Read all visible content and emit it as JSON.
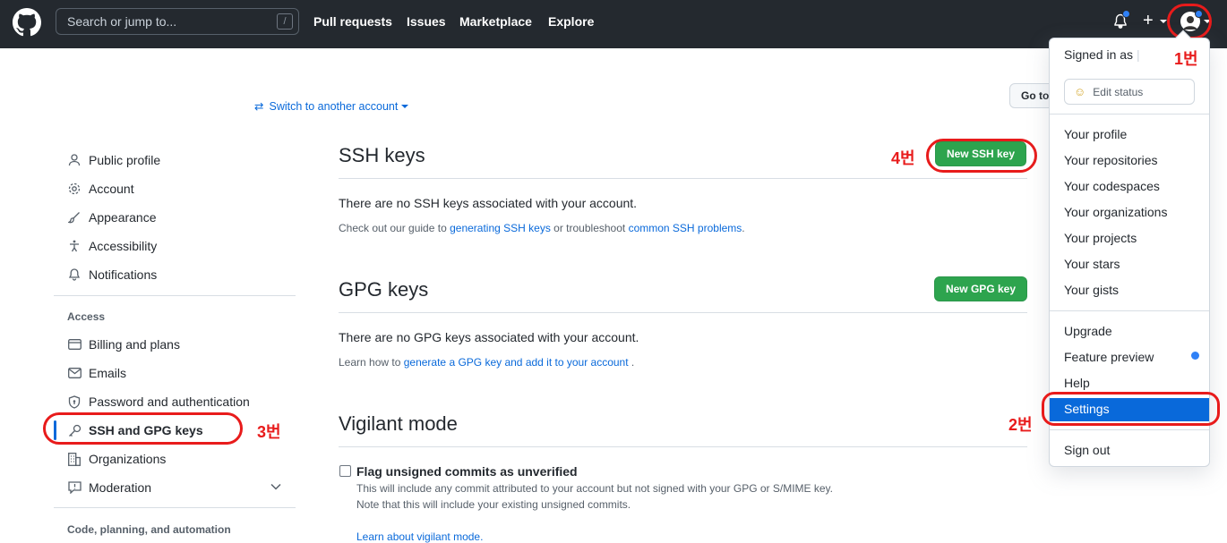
{
  "header": {
    "search_placeholder": "Search or jump to...",
    "search_shortcut": "/",
    "nav": [
      "Pull requests",
      "Issues",
      "Marketplace",
      "Explore"
    ]
  },
  "switch_account": "Switch to another account",
  "goto_button": "Go to",
  "sidebar": {
    "items": [
      "Public profile",
      "Account",
      "Appearance",
      "Accessibility",
      "Notifications"
    ],
    "access_heading": "Access",
    "access_items": [
      "Billing and plans",
      "Emails",
      "Password and authentication",
      "SSH and GPG keys",
      "Organizations",
      "Moderation"
    ],
    "code_heading": "Code, planning, and automation"
  },
  "ssh": {
    "title": "SSH keys",
    "button": "New SSH key",
    "empty": "There are no SSH keys associated with your account.",
    "guide_pre": "Check out our guide to",
    "guide_link1": "generating SSH keys",
    "guide_mid": "or troubleshoot",
    "guide_link2": "common SSH problems",
    "guide_end": "."
  },
  "gpg": {
    "title": "GPG keys",
    "button": "New GPG key",
    "empty": "There are no GPG keys associated with your account.",
    "learn_pre": "Learn how to",
    "learn_link": "generate a GPG key and add it to your account",
    "learn_end": "."
  },
  "vigilant": {
    "title": "Vigilant mode",
    "checkbox_label": "Flag unsigned commits as unverified",
    "note1": "This will include any commit attributed to your account but not signed with your GPG or S/MIME key.",
    "note2": "Note that this will include your existing unsigned commits.",
    "link": "Learn about vigilant mode."
  },
  "dropdown": {
    "signed_in": "Signed in as",
    "edit_status": "Edit status",
    "group1": [
      "Your profile",
      "Your repositories",
      "Your codespaces",
      "Your organizations",
      "Your projects",
      "Your stars",
      "Your gists"
    ],
    "group2": [
      "Upgrade",
      "Feature preview",
      "Help"
    ],
    "settings": "Settings",
    "sign_out": "Sign out"
  },
  "annotations": [
    "1번",
    "2번",
    "3번",
    "4번"
  ],
  "colors": {
    "accent": "#0969da",
    "green": "#2da44e",
    "annotation": "#e81b1b",
    "header": "#24292f"
  }
}
